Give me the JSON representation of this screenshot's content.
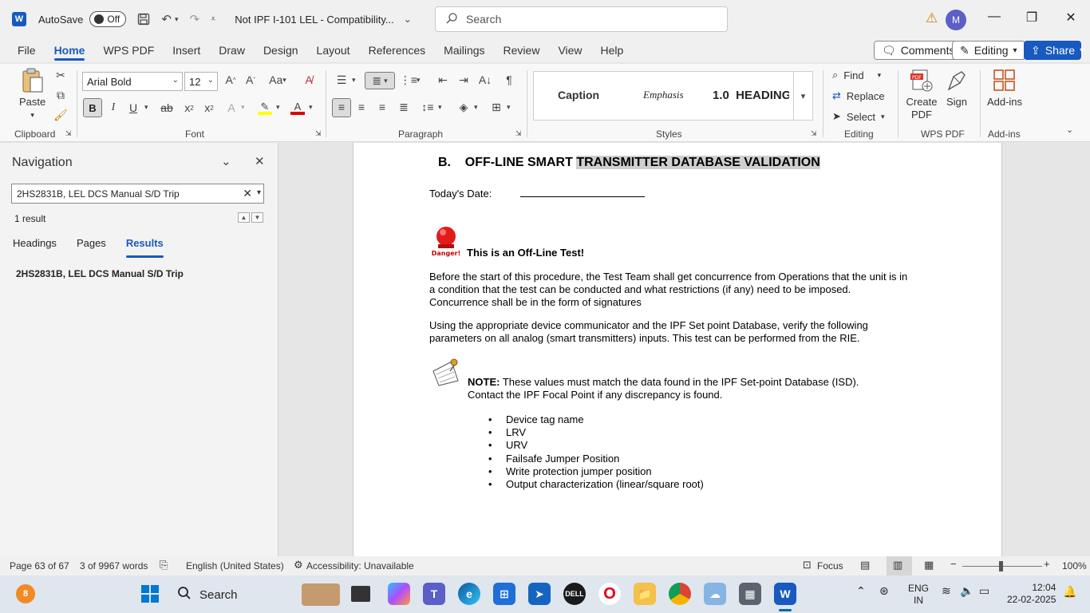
{
  "titlebar": {
    "autosave_label": "AutoSave",
    "autosave_state": "Off",
    "doc_title": "Not IPF I-101 LEL  -  Compatibility...",
    "search_placeholder": "Search",
    "avatar_initial": "M"
  },
  "tabs": [
    "File",
    "Home",
    "WPS PDF",
    "Insert",
    "Draw",
    "Design",
    "Layout",
    "References",
    "Mailings",
    "Review",
    "View",
    "Help"
  ],
  "tab_buttons": {
    "comments": "Comments",
    "editing": "Editing",
    "share": "Share"
  },
  "ribbon": {
    "clipboard": {
      "paste": "Paste",
      "label": "Clipboard"
    },
    "font": {
      "name": "Arial Bold",
      "size": "12",
      "label": "Font",
      "bold": "B",
      "italic": "I",
      "underline": "U"
    },
    "paragraph": {
      "label": "Paragraph"
    },
    "styles": {
      "items": [
        "Caption",
        "Emphasis",
        "1.0  HEADING"
      ],
      "label": "Styles"
    },
    "editing": {
      "find": "Find",
      "replace": "Replace",
      "select": "Select",
      "label": "Editing"
    },
    "wps_pdf": {
      "create_pdf": "Create PDF",
      "sign": "Sign",
      "label": "WPS PDF"
    },
    "addins": {
      "addins": "Add-ins",
      "label": "Add-ins"
    }
  },
  "navigation": {
    "title": "Navigation",
    "search_value": "2HS2831B, LEL DCS Manual S/D Trip",
    "result_count": "1 result",
    "tabs": [
      "Headings",
      "Pages",
      "Results"
    ],
    "result_item": "2HS2831B, LEL DCS Manual S/D Trip"
  },
  "document": {
    "heading_prefix": "B.    OFF-LINE SMART ",
    "heading_highlight": "TRANSMITTER DATABASE VALIDATION",
    "date_label": "Today's Date:",
    "danger_label": "Danger!",
    "offline_title": "This is an Off-Line Test!",
    "para1": "Before the start of this procedure, the Test Team shall get concurrence from Operations that the unit is in a condition that the test can be conducted and what restrictions (if any) need to be imposed. Concurrence shall be in the form of signatures",
    "para2": "Using the appropriate device communicator and the IPF Set point Database, verify the following parameters on all analog (smart transmitters) inputs. This test can be performed from the RIE.",
    "note_label": "NOTE:",
    "note_text": " These values must match the data found in the IPF Set-point Database (ISD). Contact the IPF Focal Point if any discrepancy is found.",
    "bullets": [
      "Device tag name",
      "LRV",
      "URV",
      "Failsafe Jumper Position",
      "Write protection jumper position",
      "Output characterization (linear/square root)"
    ]
  },
  "statusbar": {
    "page": "Page 63 of 67",
    "words": "3 of 9967 words",
    "language": "English (United States)",
    "accessibility": "Accessibility: Unavailable",
    "focus": "Focus",
    "zoom": "100%"
  },
  "taskbar": {
    "badge": "8",
    "search": "Search",
    "lang_line1": "ENG",
    "lang_line2": "IN",
    "time": "12:04",
    "date": "22-02-2025"
  },
  "colors": {
    "accent": "#185abd",
    "highlight": "#cfcfcf"
  }
}
